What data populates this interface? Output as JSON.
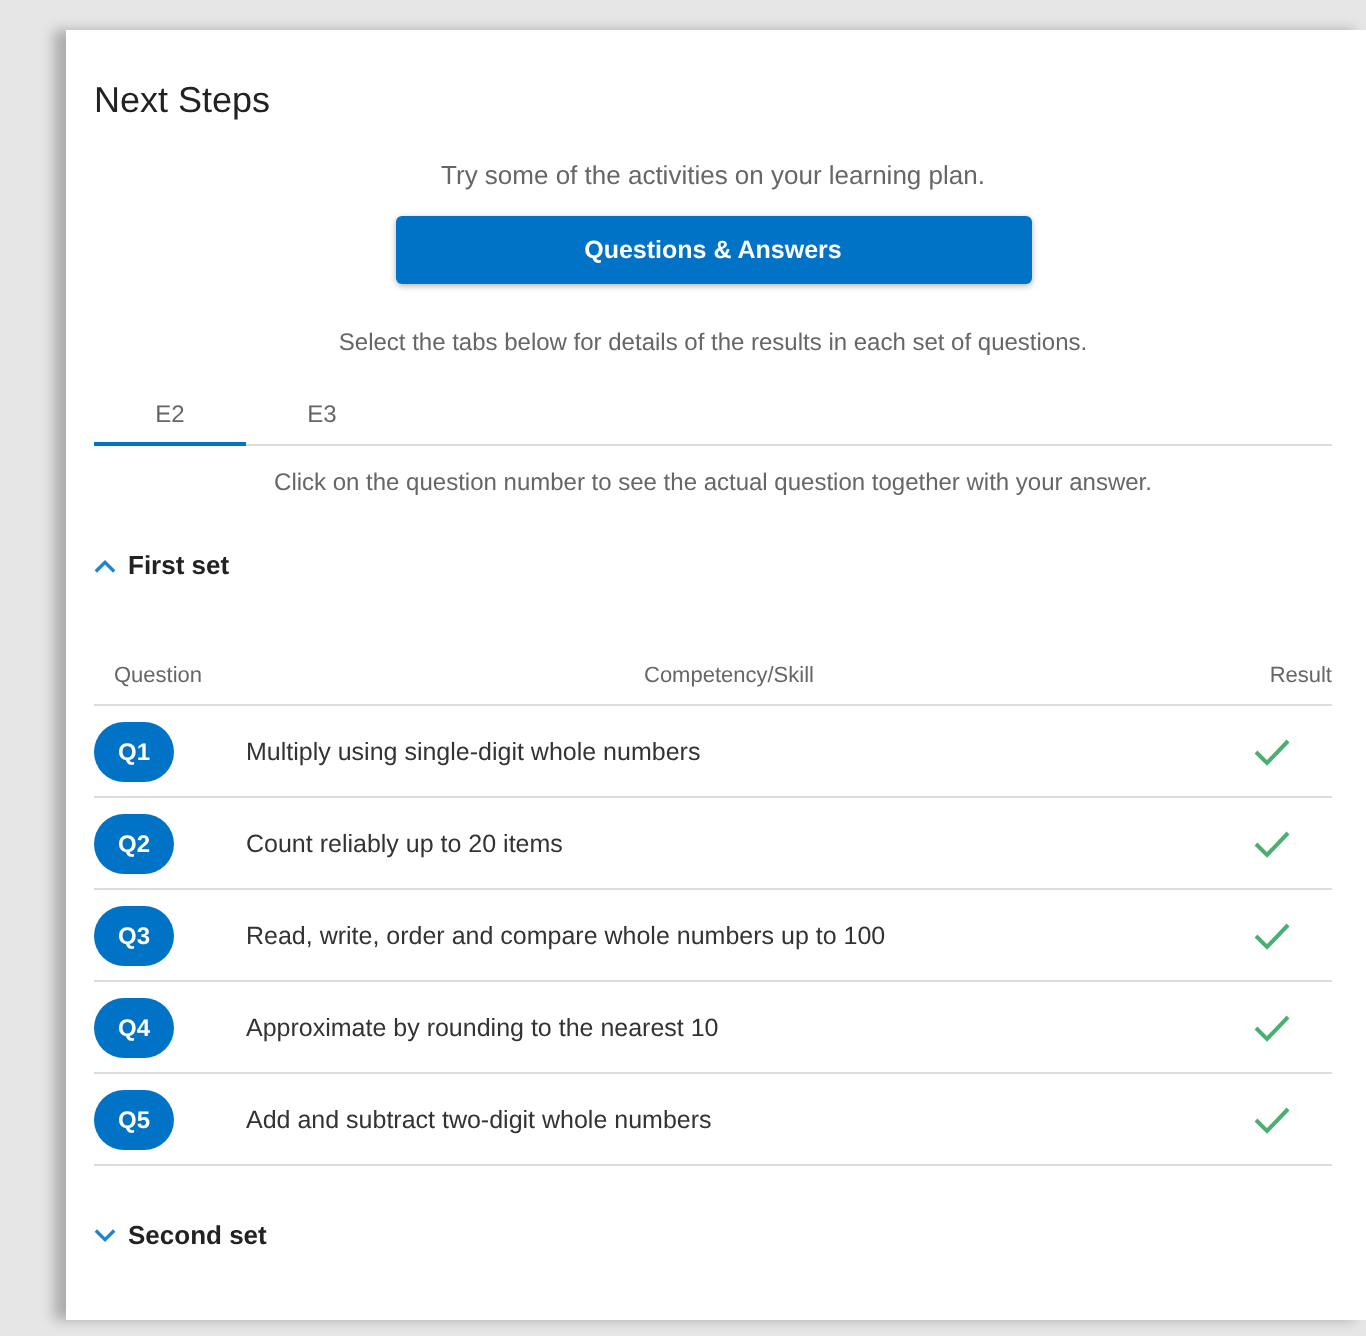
{
  "title": "Next Steps",
  "intro": "Try some of the activities on your learning plan.",
  "button": "Questions & Answers",
  "tabs_hint": "Select the tabs below for details of the results in each set of questions.",
  "tabs": [
    {
      "label": "E2",
      "selected": true
    },
    {
      "label": "E3",
      "selected": false
    }
  ],
  "note": "Click on the question number to see the actual question together with your answer.",
  "sets": [
    {
      "title": "First set",
      "expanded": true,
      "columns": [
        "Question",
        "Competency/Skill",
        "Result"
      ],
      "rows": [
        {
          "question": "Q1",
          "skill": "Multiply using single-digit whole numbers",
          "correct": true
        },
        {
          "question": "Q2",
          "skill": "Count reliably up to 20 items",
          "correct": true
        },
        {
          "question": "Q3",
          "skill": "Read, write, order and compare whole numbers up to 100",
          "correct": true
        },
        {
          "question": "Q4",
          "skill": "Approximate by rounding to the nearest 10",
          "correct": true
        },
        {
          "question": "Q5",
          "skill": "Add and subtract two-digit whole numbers",
          "correct": true
        }
      ]
    },
    {
      "title": "Second set",
      "expanded": false
    }
  ]
}
